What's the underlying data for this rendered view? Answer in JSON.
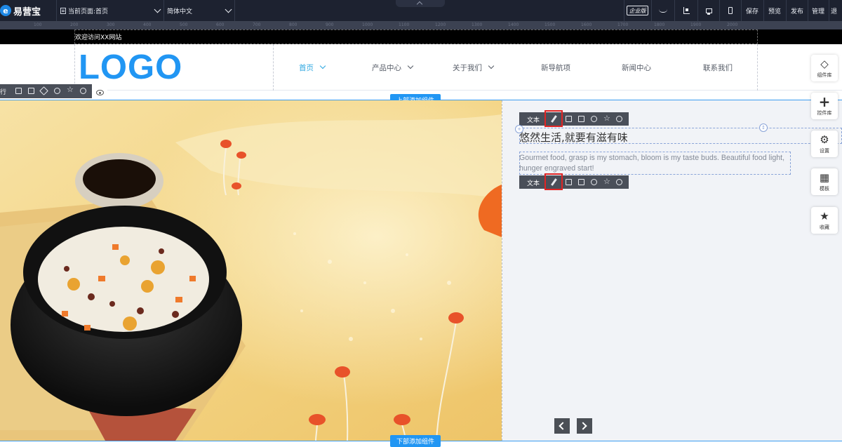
{
  "editor": {
    "brand": "易营宝",
    "current_page": "当前页面:首页",
    "language": "简体中文",
    "enterprise_badge": "企业版",
    "actions": [
      "保存",
      "预览",
      "发布",
      "管理",
      "退"
    ],
    "ruler_ticks": [
      "100",
      "200",
      "300",
      "400",
      "500",
      "600",
      "700",
      "800",
      "900",
      "1000",
      "1100",
      "1200",
      "1300",
      "1400",
      "1500",
      "1600",
      "1700",
      "1800",
      "1900",
      "2000"
    ]
  },
  "site": {
    "welcome": "欢迎访问XX网站",
    "logo": "LOGO",
    "nav": [
      "首页",
      "产品中心",
      "关于我们",
      "新导航项",
      "新闻中心",
      "联系我们"
    ]
  },
  "row_toolbar": {
    "label": "行"
  },
  "add_top": "上部添加组件",
  "add_bottom": "下部添加组件",
  "text_toolbar": {
    "label": "文本"
  },
  "content": {
    "title": "悠然生活,就要有滋有味",
    "description": "Gourmet food, grasp is my stomach, bloom is my taste buds. Beautiful food light, hunger engraved start!"
  },
  "side_tools": [
    {
      "label": "组件库",
      "icon": "cube-icon"
    },
    {
      "label": "控件库",
      "icon": "plus-icon"
    },
    {
      "label": "设置",
      "icon": "gears-icon"
    },
    {
      "label": "模板",
      "icon": "grid-icon"
    },
    {
      "label": "收藏",
      "icon": "star-icon"
    }
  ],
  "colors": {
    "topbar": "#1d2230",
    "accent": "#2196f3",
    "nav_active": "#2ea7e0",
    "highlight": "#e02424"
  }
}
